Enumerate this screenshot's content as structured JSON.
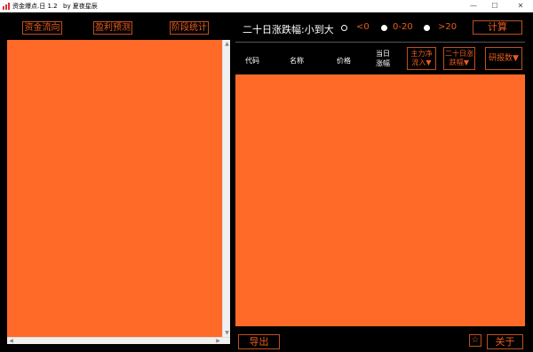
{
  "window": {
    "title": "资金爆点.日  1.2",
    "author": "by 夏夜星辰",
    "controls": {
      "minimize": "—",
      "maximize": "☐",
      "close": "✕"
    }
  },
  "toolbar": {
    "fund_flow": "资金流向",
    "profit_forecast": "盈利预测",
    "stage_stats": "阶段统计"
  },
  "sort": {
    "label": "二十日涨跌幅:小到大",
    "options": [
      "<0",
      "0-20",
      ">20"
    ],
    "calc_button": "计算"
  },
  "table": {
    "headers": {
      "code": "代码",
      "name": "名称",
      "price": "价格",
      "day_change_line1": "当日",
      "day_change_line2": "涨幅",
      "main_inflow": "主力净流入▼",
      "twenty_day_change": "二十日涨跌幅▼",
      "research_count": "研报数▼"
    }
  },
  "footer": {
    "export_button": "导出",
    "star_button": "☆",
    "about_button": "关于"
  },
  "colors": {
    "background": "#000000",
    "panel_fill": "#ff6a28",
    "accent": "#e85c1f"
  }
}
